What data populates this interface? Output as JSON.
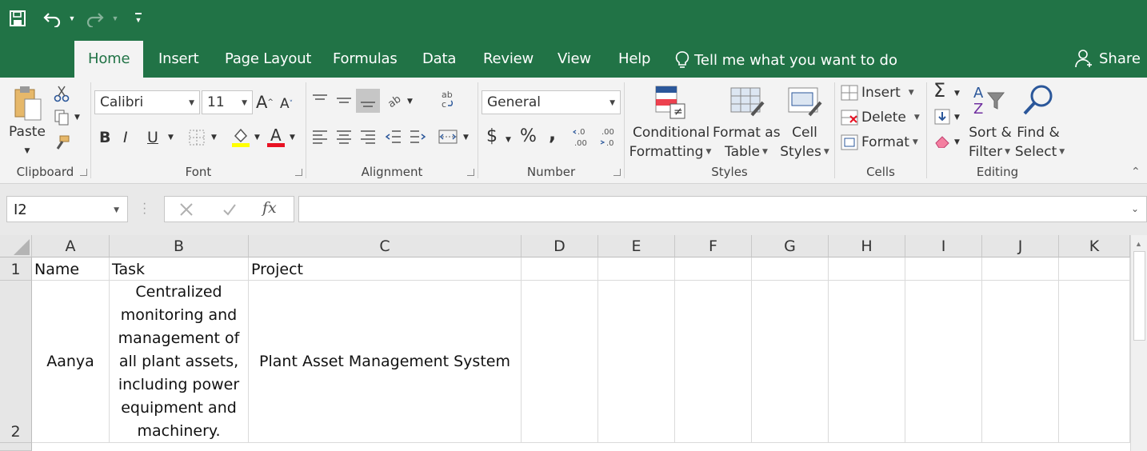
{
  "colors": {
    "brand": "#217346",
    "ribbon_bg": "#f3f3f3",
    "font_color_bar": "#e81123",
    "highlight_bar": "#ffff00"
  },
  "qat": {
    "icons": [
      "save-icon",
      "undo-icon",
      "redo-icon",
      "customize-qat-icon"
    ]
  },
  "tabs": [
    {
      "label": "Home",
      "active": true
    },
    {
      "label": "Insert"
    },
    {
      "label": "Page Layout"
    },
    {
      "label": "Formulas"
    },
    {
      "label": "Data"
    },
    {
      "label": "Review"
    },
    {
      "label": "View"
    },
    {
      "label": "Help"
    }
  ],
  "tell_me": "Tell me what you want to do",
  "share": "Share",
  "ribbon": {
    "clipboard": {
      "label": "Clipboard",
      "paste": "Paste"
    },
    "font": {
      "label": "Font",
      "font_name": "Calibri",
      "font_size": "11",
      "bold": "B",
      "italic": "I",
      "underline": "U"
    },
    "alignment": {
      "label": "Alignment"
    },
    "number": {
      "label": "Number",
      "format": "General",
      "currency": "$",
      "percent": "%",
      "comma": ","
    },
    "styles": {
      "label": "Styles",
      "conditional_1": "Conditional",
      "conditional_2": "Formatting",
      "format_table_1": "Format as",
      "format_table_2": "Table",
      "cell_styles_1": "Cell",
      "cell_styles_2": "Styles"
    },
    "cells": {
      "label": "Cells",
      "insert": "Insert",
      "delete": "Delete",
      "format": "Format"
    },
    "editing": {
      "label": "Editing",
      "sort_1": "Sort &",
      "sort_2": "Filter",
      "find_1": "Find &",
      "find_2": "Select"
    }
  },
  "formula_bar": {
    "name_box": "I2",
    "fx": "fx",
    "value": ""
  },
  "sheet": {
    "columns": [
      "A",
      "B",
      "C",
      "D",
      "E",
      "F",
      "G",
      "H",
      "I",
      "J",
      "K"
    ],
    "rows": [
      "1",
      "2"
    ],
    "row1": {
      "A": "Name",
      "B": "Task",
      "C": "Project"
    },
    "row2": {
      "A": "Aanya",
      "B": "Centralized monitoring and management of all plant assets, including power equipment and machinery.",
      "C": "Plant Asset Management System"
    }
  }
}
